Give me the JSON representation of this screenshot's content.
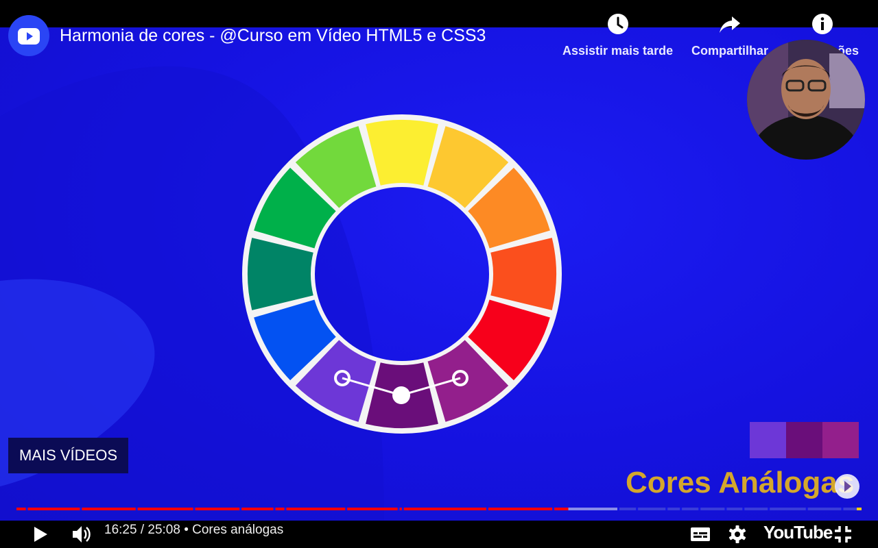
{
  "video": {
    "title": "Harmonia de cores - @Curso em Vídeo HTML5 e CSS3",
    "caption": "Cores Análogas",
    "more_videos_label": "MAIS VÍDEOS"
  },
  "top_actions": [
    {
      "label": "Assistir mais tarde",
      "icon": "clock-icon"
    },
    {
      "label": "Compartilhar",
      "icon": "share-icon"
    },
    {
      "label": "Informações",
      "icon": "info-icon"
    }
  ],
  "controls": {
    "time": "16:25 / 25:08 • Cores análogas",
    "brand": "YouTube"
  },
  "playback": {
    "current": "16:25",
    "duration": "25:08",
    "chapter": "Cores análogas",
    "progress_fraction": 0.653
  },
  "color_wheel": {
    "segments": [
      "#fcee31",
      "#fdc830",
      "#fd8a24",
      "#fb4f1d",
      "#f7001b",
      "#931f8c",
      "#6a0e7a",
      "#6d37d7",
      "#0352f2",
      "#008466",
      "#00b04a",
      "#72d93c"
    ],
    "highlighted": [
      "#6d37d7",
      "#6a0e7a",
      "#931f8c"
    ]
  },
  "swatches": [
    "#6d37d7",
    "#6a0e7a",
    "#931f8c"
  ],
  "colors": {
    "background": "#1416e8",
    "progress_played": "#ff0000",
    "caption": "#d4a72c"
  }
}
